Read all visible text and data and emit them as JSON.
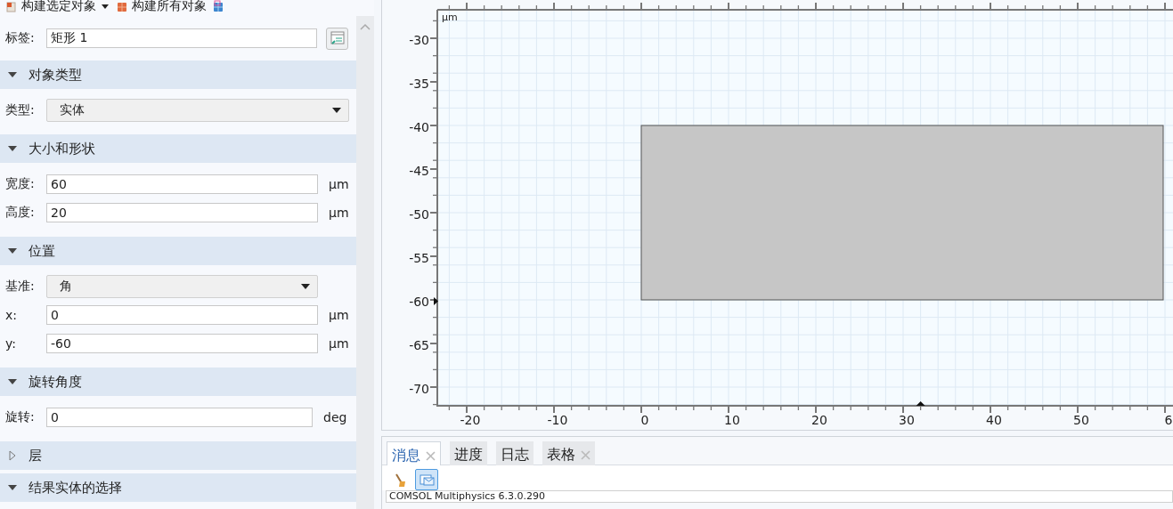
{
  "toolbar": [
    {
      "kind": "build-selected",
      "label": "构建选定对象",
      "menu": true
    },
    {
      "kind": "build-all",
      "label": "构建所有对象",
      "menu": false
    },
    {
      "kind": "cube",
      "menu": false
    }
  ],
  "label_field": {
    "label": "标签:",
    "value": "矩形 1"
  },
  "sections": [
    {
      "title": "对象类型",
      "expanded": true,
      "rows": [
        {
          "kind": "select",
          "label": "类型:",
          "value": "实体"
        }
      ]
    },
    {
      "title": "大小和形状",
      "expanded": true,
      "rows": [
        {
          "kind": "input",
          "label": "宽度:",
          "value": "60",
          "unit": "µm"
        },
        {
          "kind": "input",
          "label": "高度:",
          "value": "20",
          "unit": "µm"
        }
      ]
    },
    {
      "title": "位置",
      "expanded": true,
      "rows": [
        {
          "kind": "select",
          "label": "基准:",
          "value": "角"
        },
        {
          "kind": "input",
          "label": "x:",
          "value": "0",
          "unit": "µm"
        },
        {
          "kind": "input",
          "label": "y:",
          "value": "-60",
          "unit": "µm"
        }
      ]
    },
    {
      "title": "旋转角度",
      "expanded": true,
      "rows": [
        {
          "kind": "input",
          "label": "旋转:",
          "value": "0",
          "unit": "deg"
        }
      ]
    },
    {
      "title": "层",
      "expanded": false
    },
    {
      "title": "结果实体的选择",
      "expanded": true
    }
  ],
  "graphics": {
    "unit": "µm",
    "x_ticks": [
      "-20",
      "-10",
      "0",
      "10",
      "20",
      "30",
      "40",
      "50",
      "6"
    ],
    "y_ticks": [
      "-30",
      "-35",
      "-40",
      "-45",
      "-50",
      "-55",
      "-60",
      "-65",
      "-70"
    ]
  },
  "messages": {
    "tabs": [
      {
        "label": "消息",
        "selected": true,
        "closable": true
      },
      {
        "label": "进度",
        "selected": false,
        "closable": false
      },
      {
        "label": "日志",
        "selected": false,
        "closable": false
      },
      {
        "label": "表格",
        "selected": false,
        "closable": true
      }
    ],
    "tools": [
      {
        "kind": "broom",
        "on": false
      },
      {
        "kind": "mail",
        "on": true
      }
    ],
    "text": "COMSOL Multiphysics 6.3.0.290"
  }
}
